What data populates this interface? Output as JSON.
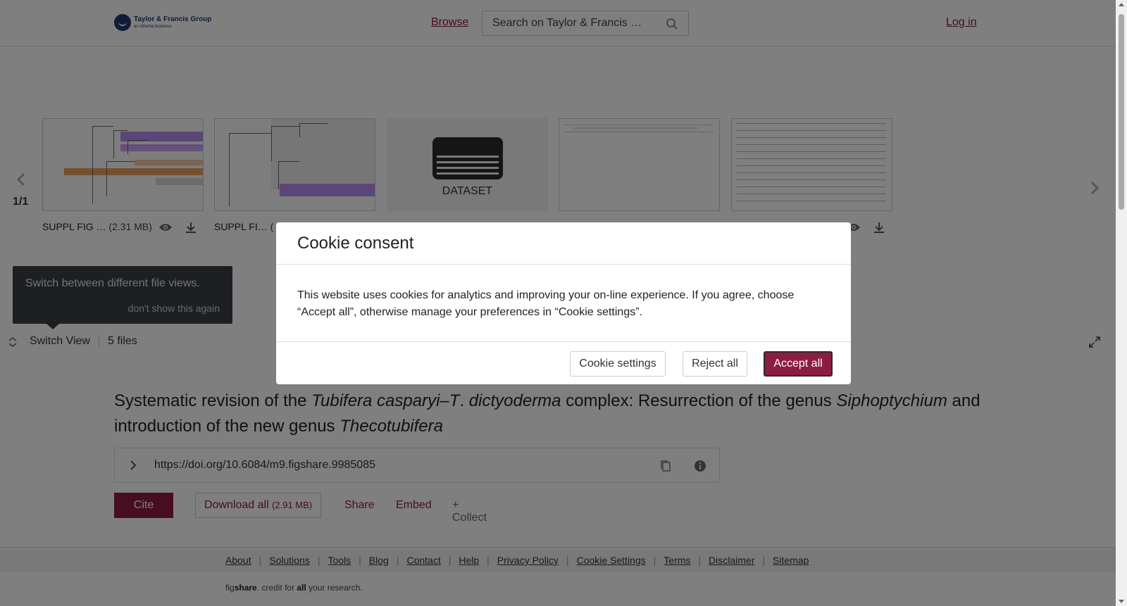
{
  "header": {
    "logo_main": "Taylor & Francis Group",
    "logo_sub": "an informa business",
    "browse_label": "Browse",
    "search_placeholder": "Search on Taylor & Francis …",
    "login_label": "Log in"
  },
  "carousel": {
    "counter": "1/1",
    "files": [
      {
        "name": "SUPPL FIG …",
        "size": "(2.31 MB)"
      },
      {
        "name": "SUPPL FI…",
        "size": "("
      },
      {
        "type_label": "DATASET"
      }
    ],
    "tooltip_text": "Switch between different file views.",
    "tooltip_dismiss": "don't show this again",
    "switch_view_label": "Switch View",
    "files_count": "5 files"
  },
  "article": {
    "title_parts": {
      "p1": "Systematic revision of the ",
      "i1": "Tubifera casparyi",
      "p2": "–",
      "i2": "T",
      "p3": ". ",
      "i3": "dictyoderma",
      "p4": " complex: Resurrection of the genus ",
      "i4": "Siphoptychium",
      "p5": " and introduction of the new genus ",
      "i5": "Thecotubifera"
    },
    "doi": "https://doi.org/10.6084/m9.figshare.9985085",
    "cite_label": "Cite",
    "download_all_label": "Download all",
    "download_all_size": "(2.91 MB)",
    "share_label": "Share",
    "embed_label": "Embed",
    "collect_label": "+ Collect"
  },
  "footer": {
    "links": [
      "About",
      "Solutions",
      "Tools",
      "Blog",
      "Contact",
      "Help",
      "Privacy Policy",
      "Cookie Settings",
      "Terms",
      "Disclaimer",
      "Sitemap"
    ],
    "brand_fig": "fig",
    "brand_share": "share",
    "brand_mid": ". credit for ",
    "brand_all": "all",
    "brand_end": " your research."
  },
  "cookie_modal": {
    "title": "Cookie consent",
    "body": "This website uses cookies for analytics and improving your on-line experience. If you agree, choose “Accept all”, otherwise manage your preferences in “Cookie settings”.",
    "settings_label": "Cookie settings",
    "reject_label": "Reject all",
    "accept_label": "Accept all"
  },
  "colors": {
    "brand": "#8c1d40",
    "overlay": "rgba(0,0,0,0.5)"
  }
}
